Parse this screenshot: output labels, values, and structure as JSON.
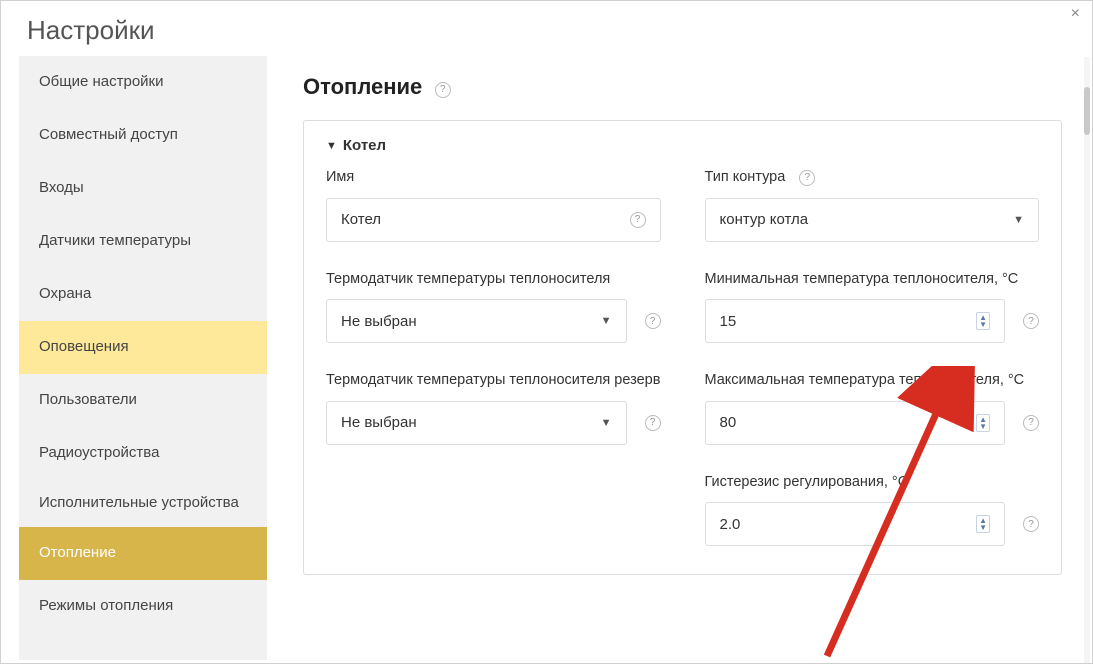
{
  "window": {
    "title": "Настройки"
  },
  "sidebar": {
    "items": [
      {
        "label": "Общие настройки",
        "state": ""
      },
      {
        "label": "Совместный доступ",
        "state": ""
      },
      {
        "label": "Входы",
        "state": ""
      },
      {
        "label": "Датчики температуры",
        "state": ""
      },
      {
        "label": "Охрана",
        "state": ""
      },
      {
        "label": "Оповещения",
        "state": "highlight"
      },
      {
        "label": "Пользователи",
        "state": ""
      },
      {
        "label": "Радиоустройства",
        "state": ""
      },
      {
        "label": "Исполнительные устройства",
        "state": "",
        "multi": true
      },
      {
        "label": "Отопление",
        "state": "active"
      },
      {
        "label": "Режимы отопления",
        "state": ""
      }
    ]
  },
  "page": {
    "heading": "Отопление",
    "card_title": "Котел",
    "fields": {
      "name_label": "Имя",
      "name_value": "Котел",
      "circuit_type_label": "Тип контура",
      "circuit_type_value": "контур котла",
      "sensor_label": "Термодатчик температуры теплоносителя",
      "sensor_value": "Не выбран",
      "sensor_reserve_label": "Термодатчик температуры теплоносителя резерв",
      "sensor_reserve_value": "Не выбран",
      "min_temp_label": "Минимальная температура теплоносителя, °C",
      "min_temp_value": "15",
      "max_temp_label": "Максимальная температура теплоносителя, °C",
      "max_temp_value": "80",
      "hysteresis_label": "Гистерезис регулирования, °C",
      "hysteresis_value": "2.0"
    }
  },
  "colors": {
    "sidebar_bg": "#f1f1f1",
    "sidebar_highlight": "#fde999",
    "sidebar_active": "#d7b54b",
    "border": "#dddddd"
  }
}
